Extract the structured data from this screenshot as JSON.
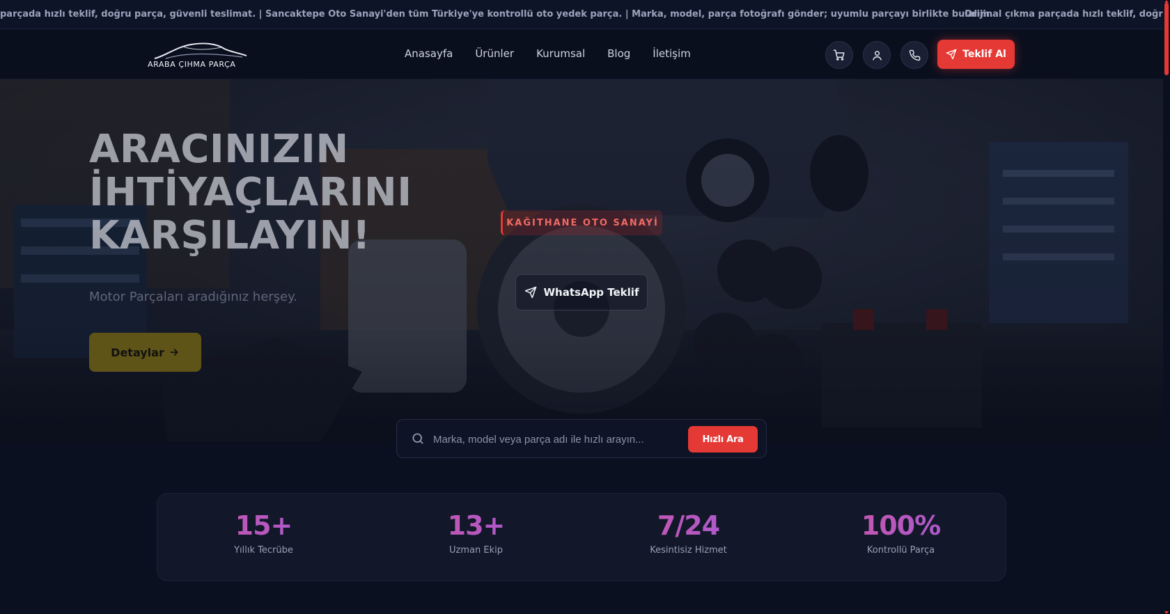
{
  "ticker": {
    "text_1": "parçada hızlı teklif, doğru parça, güvenli teslimat. | Sancaktepe Oto Sanayi'den tüm Türkiye'ye kontrollü oto yedek parça. | Marka, model, parça fotoğrafı gönder; uyumlu parçayı birlikte bulalım.",
    "text_2": "Orijinal çıkma parçada hızlı teklif, doğru parça"
  },
  "header": {
    "logo_text": "ARABA ÇIHMA PARÇA",
    "nav": [
      "Anasayfa",
      "Ürünler",
      "Kurumsal",
      "Blog",
      "İletişim"
    ],
    "icons": [
      "cart-icon",
      "user-icon",
      "phone-icon"
    ],
    "quote_button": "Teklif Al"
  },
  "hero": {
    "title_lines": [
      "ARACINIZIN",
      "İHTİYAÇLARINI",
      "KARŞILAYIN!"
    ],
    "subtitle": "Motor Parçaları aradığınız herşey.",
    "detail_button": "Detaylar",
    "badge": "KAĞITHANE OTO SANAYİ",
    "whatsapp_button": "WhatsApp Teklif"
  },
  "search": {
    "placeholder": "Marka, model veya parça adı ile hızlı arayın...",
    "value": "",
    "button": "Hızlı Ara"
  },
  "stats": [
    {
      "value": "15+",
      "label": "Yıllık Tecrübe"
    },
    {
      "value": "13+",
      "label": "Uzman Ekip"
    },
    {
      "value": "7/24",
      "label": "Kesintisiz Hizmet"
    },
    {
      "value": "100%",
      "label": "Kontrollü Parça"
    }
  ],
  "colors": {
    "accent_red": "#e53935",
    "background": "#0b1020",
    "gradient_pink": "#d4549e",
    "gradient_purple": "#9a5ce0",
    "detail_button": "#5f5417"
  }
}
